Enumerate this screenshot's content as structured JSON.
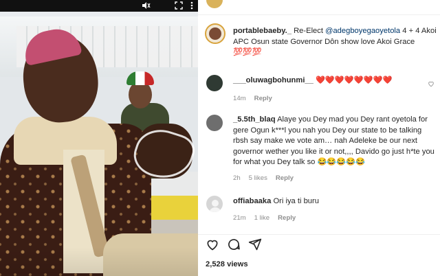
{
  "post": {
    "caption": {
      "username": "portablebaeby._",
      "text_before": "Re-Elect ",
      "mention": "@adegboyegaoyetola",
      "text_after": " 4 + 4 Akoi APC Osun state Governor Dôn show love Akoi Grace 💯💯💯"
    },
    "comments": [
      {
        "username": "___oluwagbohunmi__",
        "text": "❤️❤️❤️❤️❤️❤️❤️❤️",
        "time": "14m",
        "likes": "",
        "reply_label": "Reply"
      },
      {
        "username": "_5.5th_blaq",
        "text": "Alaye you Dey mad you Dey rant oyetola for gere Ogun k***l you nah you Dey our state to be talking rbsh say make we vote am… nah Adeleke be our next governor wether you like it or not,,,, Davido go just h*te you for what you Dey talk so 😂😂😂😂😂",
        "time": "2h",
        "likes": "5 likes",
        "reply_label": "Reply"
      },
      {
        "username": "offiabaaka",
        "text": "Ori iya ti buru",
        "time": "21m",
        "likes": "1 like",
        "reply_label": "Reply"
      }
    ],
    "views": "2,528 views"
  },
  "icons": {
    "like": "heart-icon",
    "comment": "comment-icon",
    "share": "share-icon",
    "video_mute": "speaker-icon",
    "video_fullscreen": "fullscreen-icon",
    "video_more": "more-icon"
  },
  "colors": {
    "text": "#262626",
    "muted": "#8e8e8e",
    "mention": "#00376b",
    "heart_red": "#ed4956"
  }
}
